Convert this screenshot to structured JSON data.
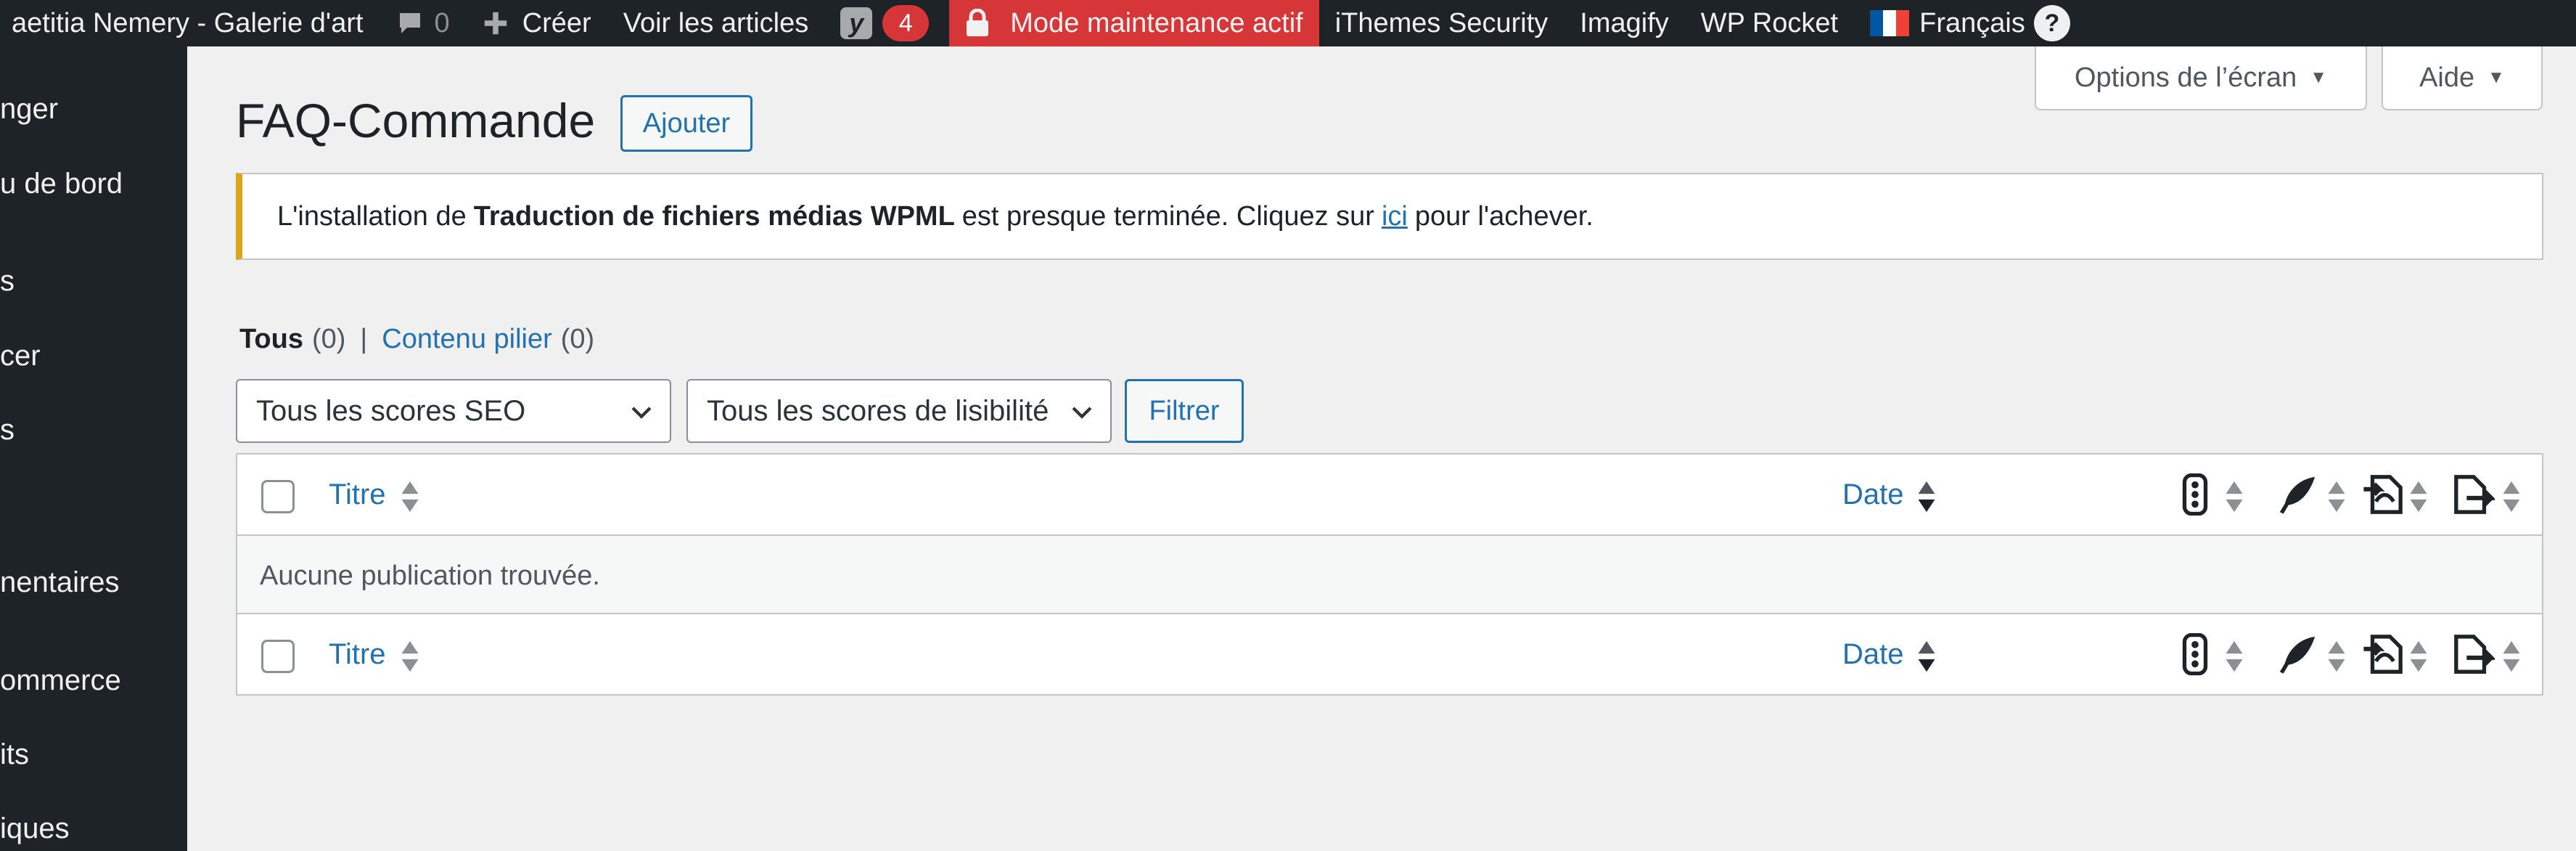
{
  "adminbar": {
    "site_name": "aetitia Nemery - Galerie d'art",
    "comments_count": "0",
    "new_label": "Créer",
    "view_posts": "Voir les articles",
    "yoast_count": "4",
    "maintenance": "Mode maintenance actif",
    "ithemes": "iThemes Security",
    "imagify": "Imagify",
    "wp_rocket": "WP Rocket",
    "language": "Français",
    "help_glyph": "?"
  },
  "sidebar": {
    "items": [
      {
        "label": "nger"
      },
      {
        "label": "u de bord"
      },
      {
        "label": "s"
      },
      {
        "label": "cer"
      },
      {
        "label": "s"
      },
      {
        "label": "nentaires"
      },
      {
        "label": "ommerce"
      },
      {
        "label": "its"
      },
      {
        "label": "iques"
      }
    ]
  },
  "screen_meta": {
    "options_label": "Options de l’écran",
    "help_label": "Aide"
  },
  "page": {
    "title": "FAQ-Commande",
    "add_new": "Ajouter"
  },
  "notice": {
    "before": "L'installation de",
    "bold": "Traduction de fichiers médias WPML",
    "middle": "est presque terminée. Cliquez sur",
    "link": "ici",
    "after": "pour l'achever."
  },
  "views": {
    "all_label": "Tous",
    "all_count": "(0)",
    "separator": "|",
    "pillar_label": "Contenu pilier",
    "pillar_count": "(0)"
  },
  "filters": {
    "seo_select": "Tous les scores SEO",
    "readability_select": "Tous les scores de lisibilité",
    "filter_button": "Filtrer"
  },
  "table": {
    "columns": {
      "title": "Titre",
      "date": "Date"
    },
    "icons": [
      "seo-score-icon",
      "readability-icon",
      "inbound-links-icon",
      "outbound-links-icon"
    ],
    "empty_message": "Aucune publication trouvée."
  },
  "colors": {
    "adminbar_bg": "#1d2327",
    "accent": "#2271b1",
    "maintenance_bg": "#d63638",
    "notice_border": "#dba617"
  }
}
